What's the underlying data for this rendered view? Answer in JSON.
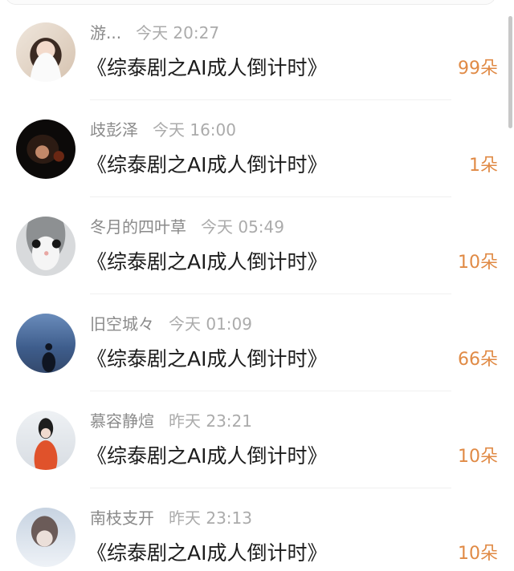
{
  "rows": [
    {
      "name": "游...",
      "time": "今天 20:27",
      "title": "《综泰剧之AI成人倒计时》",
      "count": "99朵"
    },
    {
      "name": "歧彭泽",
      "time": "今天 16:00",
      "title": "《综泰剧之AI成人倒计时》",
      "count": "1朵"
    },
    {
      "name": "冬月的四叶草",
      "time": "今天 05:49",
      "title": "《综泰剧之AI成人倒计时》",
      "count": "10朵"
    },
    {
      "name": "旧空城々",
      "time": "今天 01:09",
      "title": "《综泰剧之AI成人倒计时》",
      "count": "66朵"
    },
    {
      "name": "慕容静煊",
      "time": "昨天 23:21",
      "title": "《综泰剧之AI成人倒计时》",
      "count": "10朵"
    },
    {
      "name": "南枝支开",
      "time": "昨天 23:13",
      "title": "《综泰剧之AI成人倒计时》",
      "count": "10朵"
    }
  ],
  "colors": {
    "accent": "#e08a45",
    "name": "#8a8a8a",
    "time": "#ababab",
    "title": "#1c1c1c"
  }
}
